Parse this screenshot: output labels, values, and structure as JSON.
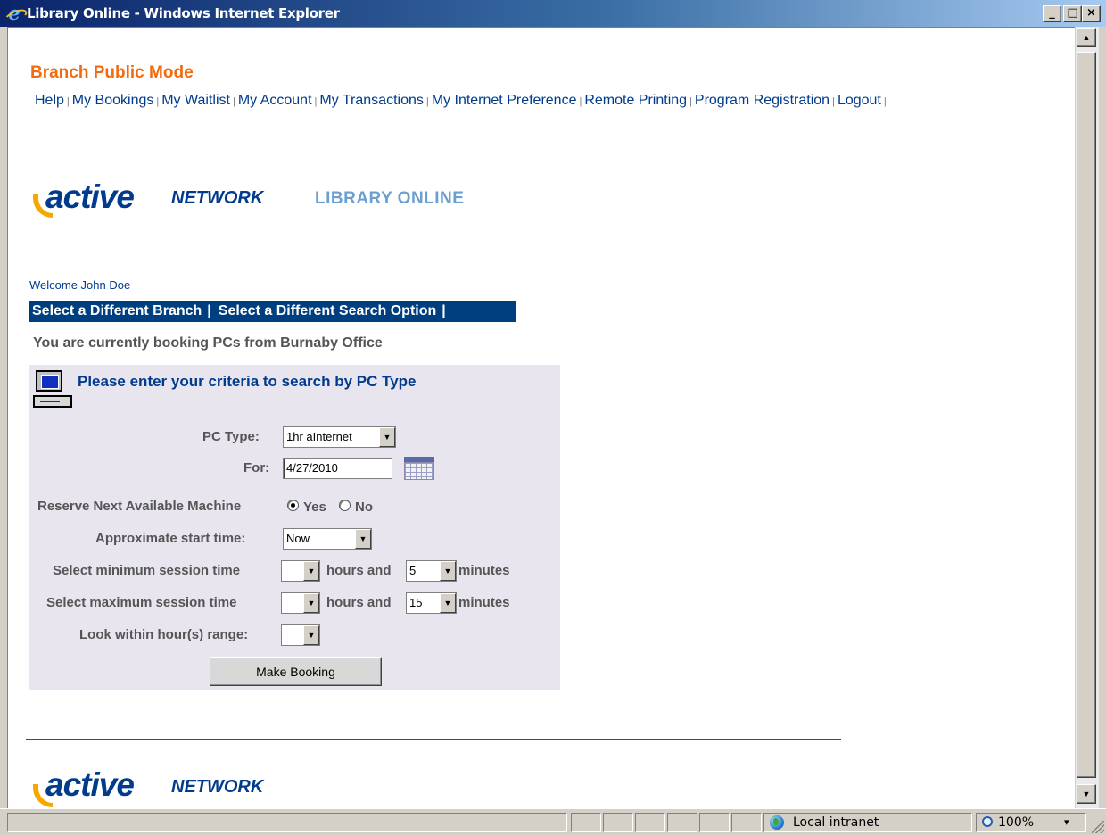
{
  "window": {
    "title": "Library Online - Windows Internet Explorer",
    "minimize": "_",
    "maximize": "□",
    "close": "×"
  },
  "page": {
    "mode_title": "Branch Public Mode",
    "nav": [
      "Help",
      "My Bookings",
      "My Waitlist",
      "My Account",
      "My Transactions",
      "My Internet Preference",
      "Remote Printing",
      "Program Registration",
      "Logout"
    ],
    "nav_separator": "|",
    "brand": {
      "active": "active",
      "network": "NETWORK",
      "library": "LIBRARY ONLINE",
      "colors": {
        "primary": "#003b8c",
        "accent": "#f6a800",
        "library": "#6a9fd0"
      }
    },
    "welcome": "Welcome John Doe",
    "options": {
      "branch": "Select a Different Branch",
      "search": "Select a Different Search Option",
      "separator": "|"
    },
    "booking_from": "You are currently booking PCs from Burnaby Office",
    "panel_title": "Please enter your criteria to search by PC Type",
    "form": {
      "pc_type_label": "PC Type:",
      "pc_type_value": "1hr aInternet",
      "for_label": "For:",
      "for_value": "4/27/2010",
      "reserve_label": "Reserve Next Available Machine",
      "reserve_yes": "Yes",
      "reserve_no": "No",
      "reserve_selected": "Yes",
      "start_label": "Approximate start time:",
      "start_value": "Now",
      "min_label": "Select minimum session time",
      "min_hours_value": "",
      "min_minutes_value": "5",
      "max_label": "Select maximum session time",
      "max_hours_value": "",
      "max_minutes_value": "15",
      "hours_and": "hours and",
      "minutes": "minutes",
      "range_label": "Look within hour(s) range:",
      "range_value": "",
      "submit": "Make Booking"
    },
    "footer_brand": {
      "active": "active",
      "network": "NETWORK"
    }
  },
  "statusbar": {
    "zone": "Local intranet",
    "zoom": "100%",
    "zoom_arrow": "▾"
  },
  "scroll": {
    "up": "▲",
    "down": "▼"
  }
}
